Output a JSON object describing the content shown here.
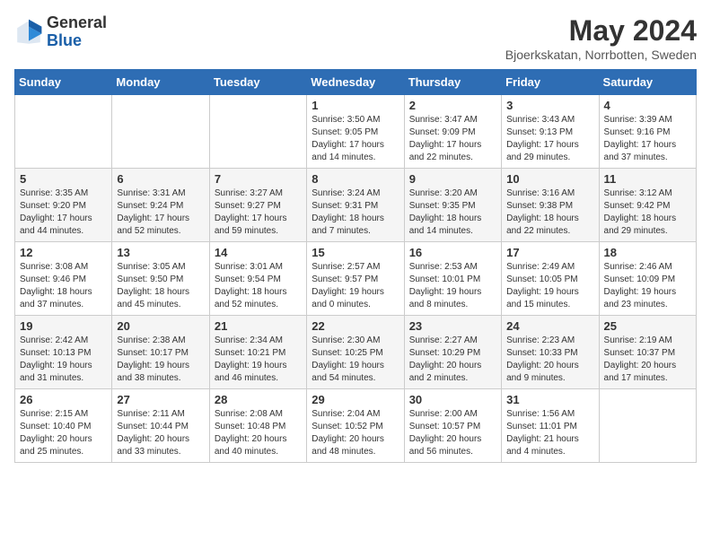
{
  "header": {
    "logo_general": "General",
    "logo_blue": "Blue",
    "month_year": "May 2024",
    "location": "Bjoerkskatan, Norrbotten, Sweden"
  },
  "days_of_week": [
    "Sunday",
    "Monday",
    "Tuesday",
    "Wednesday",
    "Thursday",
    "Friday",
    "Saturday"
  ],
  "weeks": [
    [
      {
        "day": "",
        "info": ""
      },
      {
        "day": "",
        "info": ""
      },
      {
        "day": "",
        "info": ""
      },
      {
        "day": "1",
        "info": "Sunrise: 3:50 AM\nSunset: 9:05 PM\nDaylight: 17 hours and 14 minutes."
      },
      {
        "day": "2",
        "info": "Sunrise: 3:47 AM\nSunset: 9:09 PM\nDaylight: 17 hours and 22 minutes."
      },
      {
        "day": "3",
        "info": "Sunrise: 3:43 AM\nSunset: 9:13 PM\nDaylight: 17 hours and 29 minutes."
      },
      {
        "day": "4",
        "info": "Sunrise: 3:39 AM\nSunset: 9:16 PM\nDaylight: 17 hours and 37 minutes."
      }
    ],
    [
      {
        "day": "5",
        "info": "Sunrise: 3:35 AM\nSunset: 9:20 PM\nDaylight: 17 hours and 44 minutes."
      },
      {
        "day": "6",
        "info": "Sunrise: 3:31 AM\nSunset: 9:24 PM\nDaylight: 17 hours and 52 minutes."
      },
      {
        "day": "7",
        "info": "Sunrise: 3:27 AM\nSunset: 9:27 PM\nDaylight: 17 hours and 59 minutes."
      },
      {
        "day": "8",
        "info": "Sunrise: 3:24 AM\nSunset: 9:31 PM\nDaylight: 18 hours and 7 minutes."
      },
      {
        "day": "9",
        "info": "Sunrise: 3:20 AM\nSunset: 9:35 PM\nDaylight: 18 hours and 14 minutes."
      },
      {
        "day": "10",
        "info": "Sunrise: 3:16 AM\nSunset: 9:38 PM\nDaylight: 18 hours and 22 minutes."
      },
      {
        "day": "11",
        "info": "Sunrise: 3:12 AM\nSunset: 9:42 PM\nDaylight: 18 hours and 29 minutes."
      }
    ],
    [
      {
        "day": "12",
        "info": "Sunrise: 3:08 AM\nSunset: 9:46 PM\nDaylight: 18 hours and 37 minutes."
      },
      {
        "day": "13",
        "info": "Sunrise: 3:05 AM\nSunset: 9:50 PM\nDaylight: 18 hours and 45 minutes."
      },
      {
        "day": "14",
        "info": "Sunrise: 3:01 AM\nSunset: 9:54 PM\nDaylight: 18 hours and 52 minutes."
      },
      {
        "day": "15",
        "info": "Sunrise: 2:57 AM\nSunset: 9:57 PM\nDaylight: 19 hours and 0 minutes."
      },
      {
        "day": "16",
        "info": "Sunrise: 2:53 AM\nSunset: 10:01 PM\nDaylight: 19 hours and 8 minutes."
      },
      {
        "day": "17",
        "info": "Sunrise: 2:49 AM\nSunset: 10:05 PM\nDaylight: 19 hours and 15 minutes."
      },
      {
        "day": "18",
        "info": "Sunrise: 2:46 AM\nSunset: 10:09 PM\nDaylight: 19 hours and 23 minutes."
      }
    ],
    [
      {
        "day": "19",
        "info": "Sunrise: 2:42 AM\nSunset: 10:13 PM\nDaylight: 19 hours and 31 minutes."
      },
      {
        "day": "20",
        "info": "Sunrise: 2:38 AM\nSunset: 10:17 PM\nDaylight: 19 hours and 38 minutes."
      },
      {
        "day": "21",
        "info": "Sunrise: 2:34 AM\nSunset: 10:21 PM\nDaylight: 19 hours and 46 minutes."
      },
      {
        "day": "22",
        "info": "Sunrise: 2:30 AM\nSunset: 10:25 PM\nDaylight: 19 hours and 54 minutes."
      },
      {
        "day": "23",
        "info": "Sunrise: 2:27 AM\nSunset: 10:29 PM\nDaylight: 20 hours and 2 minutes."
      },
      {
        "day": "24",
        "info": "Sunrise: 2:23 AM\nSunset: 10:33 PM\nDaylight: 20 hours and 9 minutes."
      },
      {
        "day": "25",
        "info": "Sunrise: 2:19 AM\nSunset: 10:37 PM\nDaylight: 20 hours and 17 minutes."
      }
    ],
    [
      {
        "day": "26",
        "info": "Sunrise: 2:15 AM\nSunset: 10:40 PM\nDaylight: 20 hours and 25 minutes."
      },
      {
        "day": "27",
        "info": "Sunrise: 2:11 AM\nSunset: 10:44 PM\nDaylight: 20 hours and 33 minutes."
      },
      {
        "day": "28",
        "info": "Sunrise: 2:08 AM\nSunset: 10:48 PM\nDaylight: 20 hours and 40 minutes."
      },
      {
        "day": "29",
        "info": "Sunrise: 2:04 AM\nSunset: 10:52 PM\nDaylight: 20 hours and 48 minutes."
      },
      {
        "day": "30",
        "info": "Sunrise: 2:00 AM\nSunset: 10:57 PM\nDaylight: 20 hours and 56 minutes."
      },
      {
        "day": "31",
        "info": "Sunrise: 1:56 AM\nSunset: 11:01 PM\nDaylight: 21 hours and 4 minutes."
      },
      {
        "day": "",
        "info": ""
      }
    ]
  ]
}
